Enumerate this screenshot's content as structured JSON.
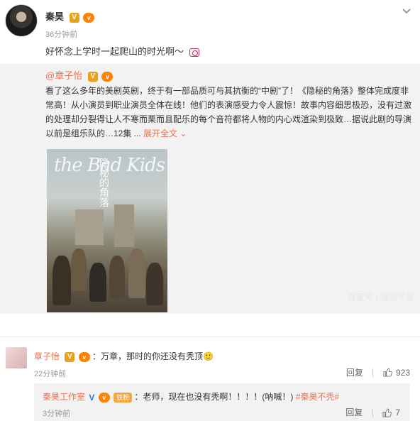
{
  "post": {
    "author": "秦昊",
    "time": "36分钟前",
    "text": "好怀念上学时一起爬山的时光啊～"
  },
  "repost": {
    "author": "@章子怡",
    "body": "看了这么多年的美剧英剧，终于有一部品质可与其抗衡的“中剧”了！《隐秘的角落》整体完成度非常高！从小演员到职业演员全体在线！他们的表演感受力令人震惊！故事内容细思极恐，没有过激的处理却分裂得让人不寒而栗而且配乐的每个音符都将人物的内心戏渲染到极致…据说此剧的导演以前是组乐队的…12集 ...",
    "expand_label": "展开全文",
    "poster_title": "the Bad Kids",
    "poster_title_cn": "隐秘的角落",
    "watermark": "百家号 / 娱乐千里"
  },
  "comment": {
    "author": "章子怡",
    "text": "：万章，那时的你还没有秃顶🙂",
    "time": "22分钟前",
    "reply_label": "回复",
    "likes": "923"
  },
  "reply": {
    "author": "秦昊工作室",
    "fan_badge": "铁粉",
    "text": "：老师，现在也没有秃啊！！！！(呐喊！)",
    "hashtag": "#秦昊不秃#",
    "time": "3分钟前",
    "reply_label": "回复",
    "likes": "7"
  },
  "icons": {
    "verified": "V",
    "vip": "vip-badge",
    "camera": "camera-icon",
    "chevron": "chevron-down-icon",
    "thumb": "thumb-up-icon"
  },
  "colors": {
    "accent": "#eb7350",
    "verified_gold": "#e8a21a",
    "verified_blue": "#2a7ae2"
  }
}
